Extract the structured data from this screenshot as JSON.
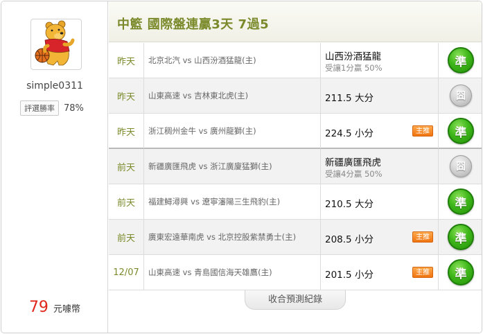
{
  "profile": {
    "username": "simple0311",
    "rate_label": "評選勝率",
    "rate_value": "78%",
    "coins_value": "79",
    "coins_unit": "元噱幣",
    "avatar_icon": "pooh-basketball-avatar"
  },
  "header": {
    "title": "中籃 國際盤連贏3天 7過5"
  },
  "rows": [
    {
      "day": "昨天",
      "match": "北京北汽 vs 山西汾酒猛龍(主)",
      "pick": "山西汾酒猛龍",
      "pick_sub": "受讓1分贏 50%",
      "badge": "",
      "result": "準",
      "result_type": "win"
    },
    {
      "day": "昨天",
      "match": "山東高速 vs 吉林東北虎(主)",
      "pick": "211.5 大分",
      "pick_sub": "",
      "badge": "",
      "result": "囧",
      "result_type": "push"
    },
    {
      "day": "昨天",
      "match": "浙江稠州金牛 vs 廣州龍獅(主)",
      "pick": "224.5 小分",
      "pick_sub": "",
      "badge": "主推",
      "result": "準",
      "result_type": "win"
    },
    {
      "day": "前天",
      "match": "新疆廣匯飛虎 vs 浙江廣廈猛獅(主)",
      "pick": "新疆廣匯飛虎",
      "pick_sub": "受讓4分贏 50%",
      "badge": "",
      "result": "囧",
      "result_type": "push"
    },
    {
      "day": "前天",
      "match": "福建鱘潯興 vs 遼寧瀋陽三生飛豹(主)",
      "pick": "210.5 大分",
      "pick_sub": "",
      "badge": "",
      "result": "準",
      "result_type": "win"
    },
    {
      "day": "前天",
      "match": "廣東宏遠華南虎 vs 北京控股紫禁勇士(主)",
      "pick": "208.5 小分",
      "pick_sub": "",
      "badge": "主推",
      "result": "準",
      "result_type": "win"
    },
    {
      "day": "12/07",
      "match": "山東高速 vs 青島國信海天雄鷹(主)",
      "pick": "201.5 小分",
      "pick_sub": "",
      "badge": "主推",
      "result": "準",
      "result_type": "win"
    }
  ],
  "footer": {
    "collapse_label": "收合預測紀錄"
  },
  "colors": {
    "accent": "#7a8a2a",
    "win": "#3fb81a",
    "push": "#bdbdbd",
    "badge": "#f0740f",
    "coins": "#e0261b"
  }
}
